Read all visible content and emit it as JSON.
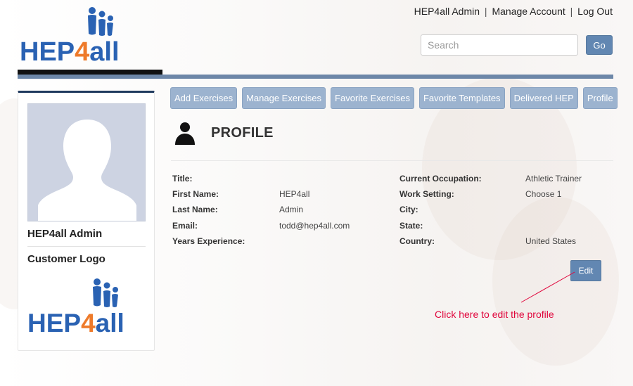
{
  "brand": {
    "logo_text_hep": "HEP",
    "logo_text_4": "4",
    "logo_text_all": "all"
  },
  "header": {
    "user_link": "HEP4all Admin",
    "manage_account": "Manage Account",
    "logout": "Log Out",
    "separator": "|"
  },
  "search": {
    "placeholder": "Search",
    "button_label": "Go"
  },
  "sidebar": {
    "user_name": "HEP4all Admin",
    "logo_label": "Customer Logo"
  },
  "tabs": [
    {
      "label": "Add Exercises"
    },
    {
      "label": "Manage Exercises"
    },
    {
      "label": "Favorite Exercises"
    },
    {
      "label": "Favorite Templates"
    },
    {
      "label": "Delivered HEP"
    },
    {
      "label": "Profile"
    }
  ],
  "profile": {
    "title": "PROFILE",
    "left_fields": [
      {
        "label": "Title:",
        "value": ""
      },
      {
        "label": "First Name:",
        "value": "HEP4all"
      },
      {
        "label": "Last Name:",
        "value": "Admin"
      },
      {
        "label": "Email:",
        "value": "todd@hep4all.com"
      },
      {
        "label": "Years Experience:",
        "value": ""
      }
    ],
    "right_fields": [
      {
        "label": "Current Occupation:",
        "value": "Athletic Trainer"
      },
      {
        "label": "Work Setting:",
        "value": "Choose 1"
      },
      {
        "label": "City:",
        "value": ""
      },
      {
        "label": "State:",
        "value": ""
      },
      {
        "label": "Country:",
        "value": "United States"
      }
    ],
    "edit_label": "Edit"
  },
  "annotation": {
    "text": "Click here to edit the profile",
    "color": "#e0063c"
  },
  "colors": {
    "accent": "#6287b2",
    "tab_bg": "#9cb3cf",
    "rule": "#6d87a8",
    "logo_blue": "#2a62b3",
    "logo_orange": "#ee7a2a"
  }
}
